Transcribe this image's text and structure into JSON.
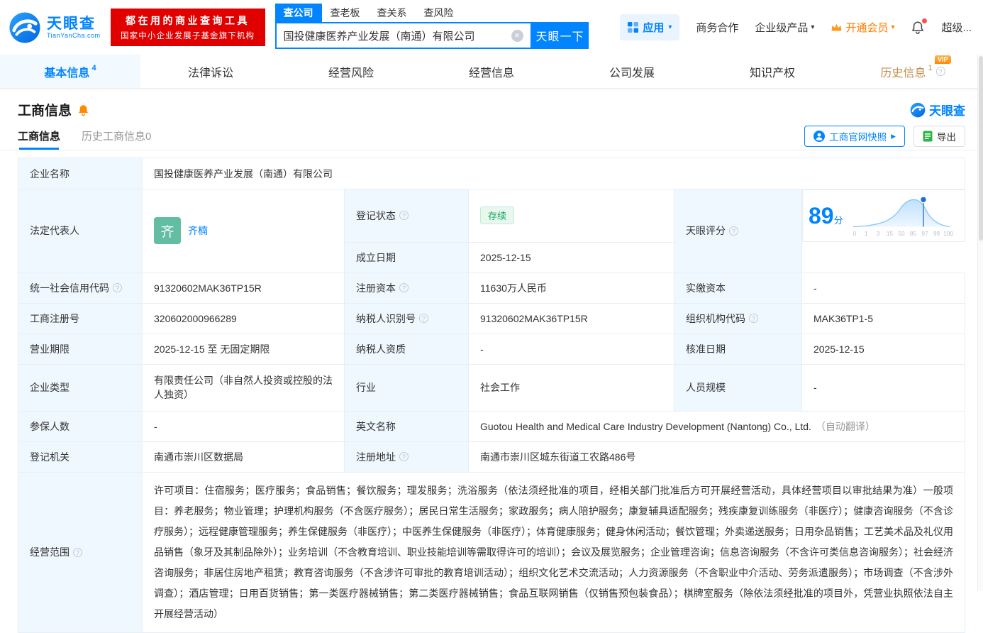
{
  "header": {
    "logo_title": "天眼查",
    "logo_subtitle": "TianYanCha.com",
    "promo_line1": "都在用的商业查询工具",
    "promo_line2": "国家中小企业发展子基金旗下机构",
    "search_tabs": [
      "查公司",
      "查老板",
      "查关系",
      "查风险"
    ],
    "search_value": "国投健康医养产业发展（南通）有限公司",
    "search_button": "天眼一下",
    "nav": {
      "app": "应用",
      "coop": "商务合作",
      "enterprise": "企业级产品",
      "member": "开通会员",
      "super": "超级..."
    }
  },
  "tabs": [
    {
      "label": "基本信息",
      "count": "4"
    },
    {
      "label": "法律诉讼",
      "count": ""
    },
    {
      "label": "经营风险",
      "count": ""
    },
    {
      "label": "经营信息",
      "count": ""
    },
    {
      "label": "公司发展",
      "count": ""
    },
    {
      "label": "知识产权",
      "count": ""
    },
    {
      "label": "历史信息",
      "count": "1",
      "vip": "VIP"
    }
  ],
  "section": {
    "title": "工商信息",
    "brand": "天眼查",
    "subtabs": [
      "工商信息",
      "历史工商信息0"
    ],
    "actions": {
      "snapshot": "工商官网快照",
      "export": "导出"
    }
  },
  "fields": {
    "company_name": {
      "label": "企业名称",
      "value": "国投健康医养产业发展（南通）有限公司"
    },
    "legal_rep": {
      "label": "法定代表人",
      "avatar": "齐",
      "value": "齐楠"
    },
    "reg_status": {
      "label": "登记状态",
      "value": "存续"
    },
    "establish_date": {
      "label": "成立日期",
      "value": "2025-12-15"
    },
    "score": {
      "label": "天眼评分",
      "value": "89",
      "unit": "分",
      "axis": [
        "0",
        "1",
        "3",
        "15",
        "50",
        "85",
        "97",
        "99",
        "100"
      ]
    },
    "credit_code": {
      "label": "统一社会信用代码",
      "value": "91320602MAK36TP15R"
    },
    "reg_capital": {
      "label": "注册资本",
      "value": "11630万人民币"
    },
    "paid_capital": {
      "label": "实缴资本",
      "value": "-"
    },
    "reg_number": {
      "label": "工商注册号",
      "value": "320602000966289"
    },
    "taxpayer_id": {
      "label": "纳税人识别号",
      "value": "91320602MAK36TP15R"
    },
    "org_code": {
      "label": "组织机构代码",
      "value": "MAK36TP1-5"
    },
    "business_term": {
      "label": "营业期限",
      "value": "2025-12-15 至 无固定期限"
    },
    "taxpayer_qualification": {
      "label": "纳税人资质",
      "value": "-"
    },
    "approval_date": {
      "label": "核准日期",
      "value": "2025-12-15"
    },
    "company_type": {
      "label": "企业类型",
      "value": "有限责任公司（非自然人投资或控股的法人独资）"
    },
    "industry": {
      "label": "行业",
      "value": "社会工作"
    },
    "staff_size": {
      "label": "人员规模",
      "value": "-"
    },
    "insured_count": {
      "label": "参保人数",
      "value": "-"
    },
    "english_name": {
      "label": "英文名称",
      "value": "Guotou Health and Medical Care Industry Development (Nantong) Co., Ltd.",
      "note": "（自动翻译）"
    },
    "registry": {
      "label": "登记机关",
      "value": "南通市崇川区数据局"
    },
    "address": {
      "label": "注册地址",
      "value": "南通市崇川区城东街道工农路486号"
    },
    "business_scope": {
      "label": "经营范围",
      "value": "许可项目：住宿服务；医疗服务；食品销售；餐饮服务；理发服务；洗浴服务（依法须经批准的项目，经相关部门批准后方可开展经营活动，具体经营项目以审批结果为准）一般项目：养老服务；物业管理；护理机构服务（不含医疗服务）；居民日常生活服务；家政服务；病人陪护服务；康复辅具适配服务；残疾康复训练服务（非医疗）；健康咨询服务（不含诊疗服务）；远程健康管理服务；养生保健服务（非医疗）；中医养生保健服务（非医疗）；体育健康服务；健身休闲活动；餐饮管理；外卖递送服务；日用杂品销售；工艺美术品及礼仪用品销售（象牙及其制品除外）；业务培训（不含教育培训、职业技能培训等需取得许可的培训）；会议及展览服务；企业管理咨询；信息咨询服务（不含许可类信息咨询服务）；社会经济咨询服务；非居住房地产租赁；教育咨询服务（不含涉许可审批的教育培训活动）；组织文化艺术交流活动；人力资源服务（不含职业中介活动、劳务派遣服务）；市场调查（不含涉外调查）；酒店管理；日用百货销售；第一类医疗器械销售；第二类医疗器械销售；食品互联网销售（仅销售预包装食品）；棋牌室服务（除依法须经批准的项目外，凭营业执照依法自主开展经营活动）"
    }
  }
}
